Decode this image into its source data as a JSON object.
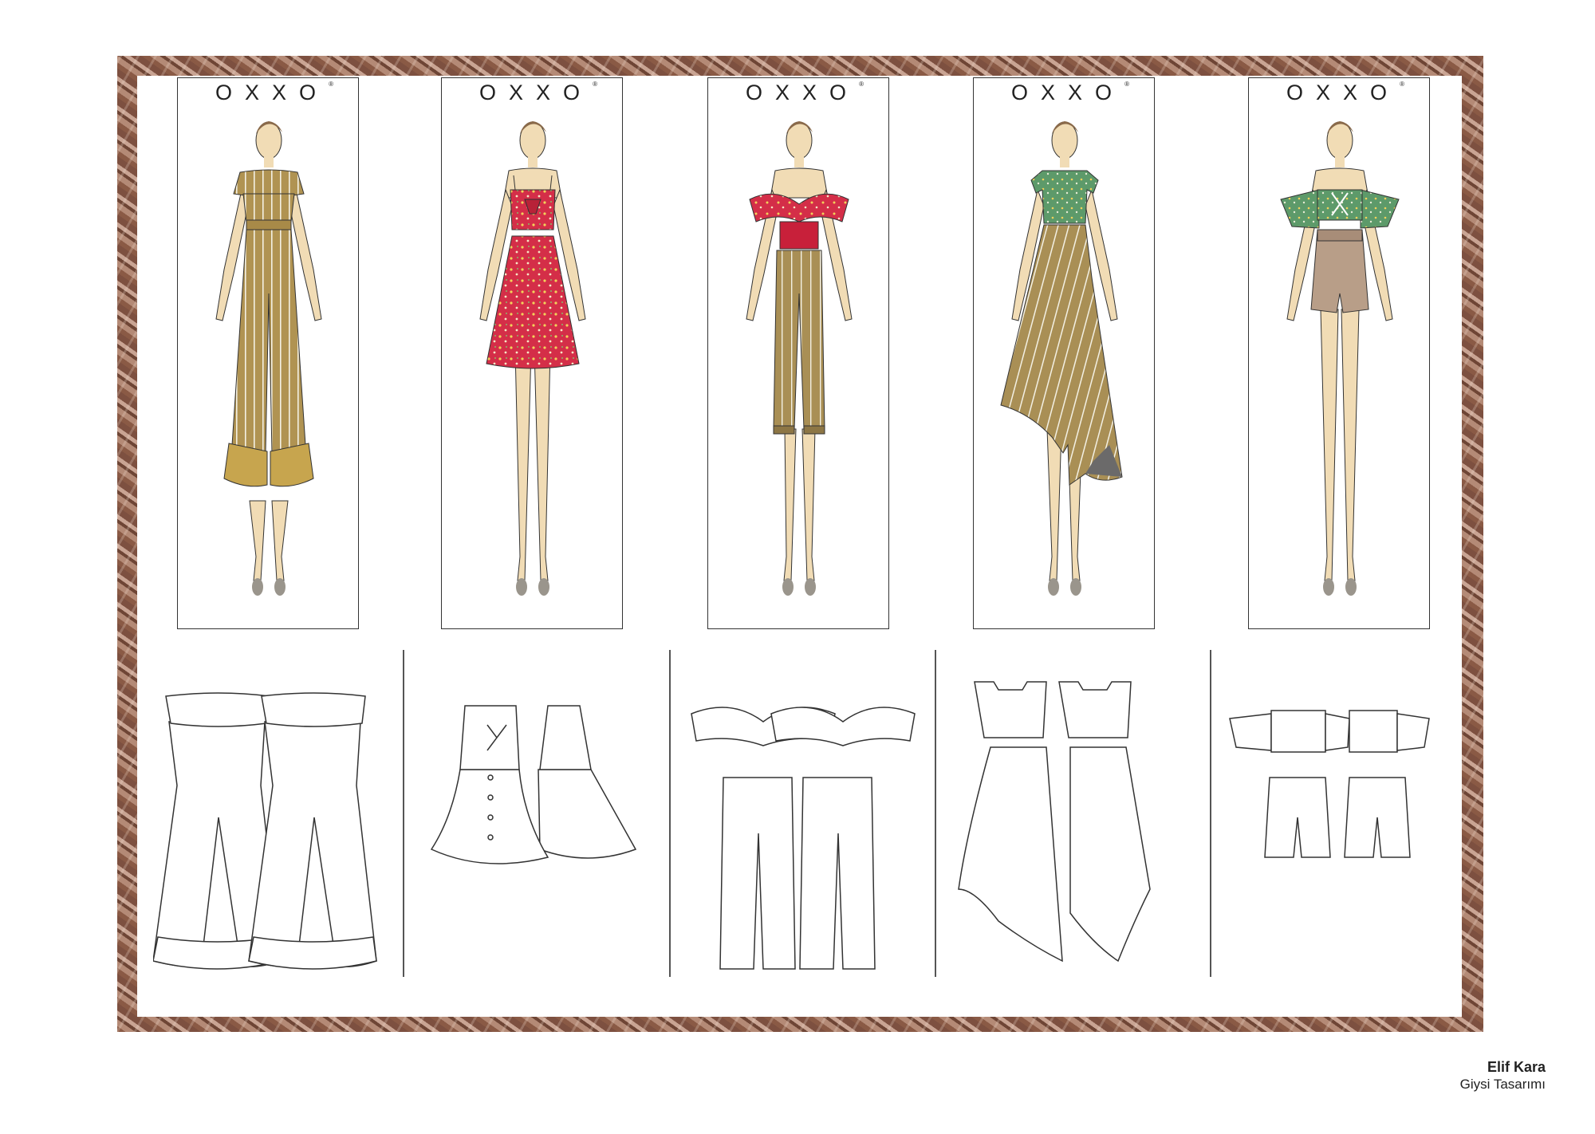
{
  "brand": "OXXO",
  "looks": [
    {
      "id": 1,
      "brand": "OXXO",
      "palette": [
        "#b09352",
        "#f3f0e3"
      ]
    },
    {
      "id": 2,
      "brand": "OXXO",
      "palette": [
        "#d42e48",
        "#f2d25a"
      ]
    },
    {
      "id": 3,
      "brand": "OXXO",
      "palette": [
        "#d42e48",
        "#a98f55"
      ]
    },
    {
      "id": 4,
      "brand": "OXXO",
      "palette": [
        "#5d9a6a",
        "#a98f55"
      ]
    },
    {
      "id": 5,
      "brand": "OXXO",
      "palette": [
        "#5d9a6a",
        "#b89e88"
      ]
    }
  ],
  "credit": {
    "designer": "Elif Kara",
    "course": "Giysi Tasarımı"
  },
  "colors": {
    "frame": "#9b6e5a",
    "skin": "#f1dcb5",
    "shoe": "#9a958c",
    "hair": "#8a6a4a"
  }
}
